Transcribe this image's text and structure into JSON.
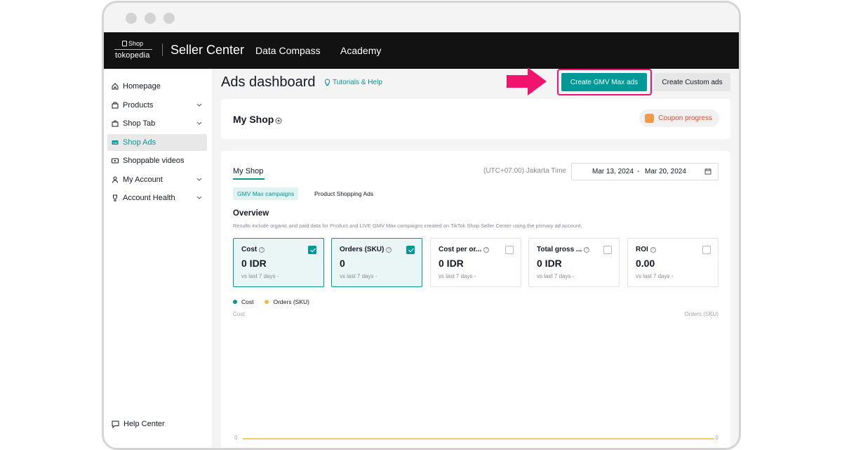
{
  "topbar": {
    "logo_shop": "Shop",
    "logo_tokopedia": "tokopedia",
    "brand": "Seller Center",
    "nav": [
      "Data Compass",
      "Academy"
    ]
  },
  "sidebar": {
    "items": [
      {
        "label": "Homepage",
        "icon": "home-icon"
      },
      {
        "label": "Products",
        "icon": "box-icon",
        "expandable": true
      },
      {
        "label": "Shop Tab",
        "icon": "shop-tab-icon",
        "expandable": true
      },
      {
        "label": "Shop Ads",
        "icon": "ad-icon",
        "active": true
      },
      {
        "label": "Shoppable videos",
        "icon": "video-icon"
      },
      {
        "label": "My Account",
        "icon": "user-icon",
        "expandable": true
      },
      {
        "label": "Account Health",
        "icon": "trophy-icon",
        "expandable": true
      }
    ],
    "help": "Help Center"
  },
  "header": {
    "title": "Ads dashboard",
    "tutorials": "Tutorials & Help",
    "create_gmv": "Create GMV Max ads",
    "create_custom": "Create Custom ads"
  },
  "shop_card": {
    "title": "My Shop",
    "coupon": "Coupon progress"
  },
  "overview_card": {
    "tab": "My Shop",
    "timezone": "(UTC+07:00) Jakarta Time",
    "date_from": "Mar 13, 2024",
    "date_sep": "-",
    "date_to": "Mar 20, 2024",
    "pills": [
      "GMV Max campaigns",
      "Product Shopping Ads"
    ],
    "overview_title": "Overview",
    "overview_desc": "Results include organic and paid data for Product and LIVE GMV Max campaigns created on TikTok Shop Seller Center using the primary ad account.",
    "metrics": [
      {
        "label": "Cost",
        "value": "0 IDR",
        "vs": "vs last 7 days -",
        "checked": true
      },
      {
        "label": "Orders (SKU)",
        "value": "0",
        "vs": "vs last 7 days -",
        "checked": true
      },
      {
        "label": "Cost per or...",
        "value": "0 IDR",
        "vs": "vs last 7 days -",
        "checked": false
      },
      {
        "label": "Total gross ...",
        "value": "0 IDR",
        "vs": "vs last 7 days -",
        "checked": false
      },
      {
        "label": "ROI",
        "value": "0.00",
        "vs": "vs last 7 days -",
        "checked": false
      }
    ],
    "legend": [
      {
        "label": "Cost",
        "color": "#009995"
      },
      {
        "label": "Orders (SKU)",
        "color": "#f5b942"
      }
    ],
    "axis_left": "Cost",
    "axis_right": "Orders (SKU)",
    "zero_left": "0",
    "zero_right": "0"
  },
  "colors": {
    "accent": "#009995",
    "highlight": "#f0146e",
    "topbar": "#121212"
  }
}
